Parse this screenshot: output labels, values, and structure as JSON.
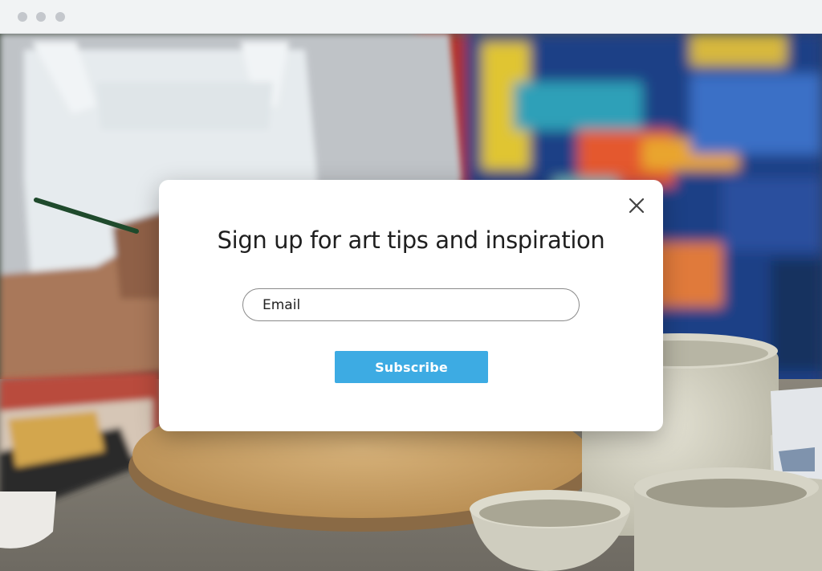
{
  "window": {
    "controls": [
      "dot",
      "dot",
      "dot"
    ],
    "control_color": "#c4c7cc"
  },
  "background": {
    "description_icon": "painter-studio-photo"
  },
  "popup": {
    "title": "Sign up for art tips and inspiration",
    "email": {
      "placeholder": "Email",
      "value": ""
    },
    "subscribe_label": "Subscribe",
    "close_icon": "close-icon",
    "accent_color": "#3dabe3"
  }
}
